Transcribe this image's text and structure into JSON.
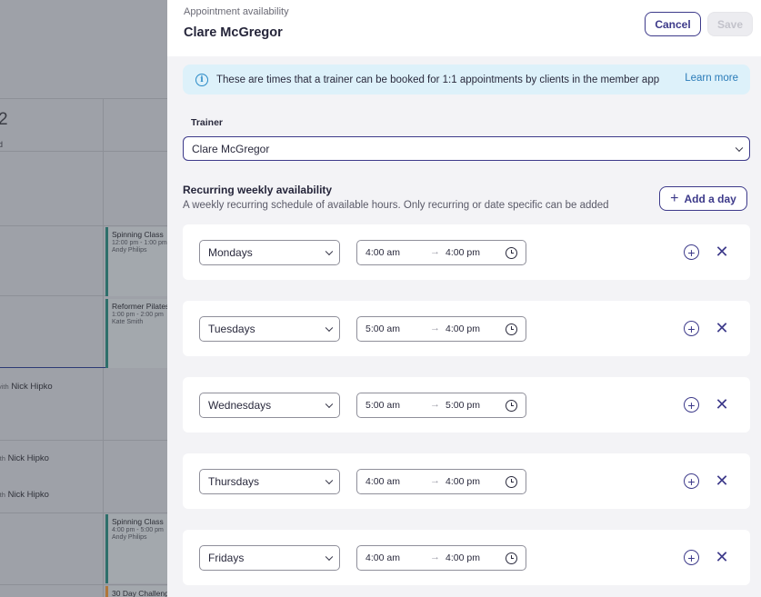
{
  "background_calendar": {
    "day_number": "2",
    "day_sub": "d",
    "events": [
      {
        "title": "Spinning Class",
        "time": "12:00 pm - 1:00 pm",
        "trainer": "Andy Philips"
      },
      {
        "title": "Reformer Pilates",
        "time": "1:00 pm - 2:00 pm",
        "trainer": "Kate Smith"
      },
      {
        "title": "Spinning Class",
        "time": "4:00 pm - 5:00 pm",
        "trainer": "Andy Philips"
      },
      {
        "title": "30 Day Challeng",
        "time": "",
        "trainer": ""
      }
    ],
    "with_prefix": "vith",
    "with_prefix_short": "ith",
    "with_name": "Nick Hipko"
  },
  "drawer": {
    "eyebrow": "Appointment availability",
    "title": "Clare McGregor",
    "cancel_label": "Cancel",
    "save_label": "Save",
    "info": {
      "text": "These are times that a trainer can be booked for 1:1 appointments by clients in the member app",
      "link": "Learn more"
    },
    "trainer_label": "Trainer",
    "trainer_value": "Clare McGregor",
    "section_title": "Recurring weekly availability",
    "section_sub": "A weekly recurring schedule of available hours. Only recurring or date specific can be added",
    "add_day_label": "Add a day",
    "rows": [
      {
        "day": "Mondays",
        "start": "4:00 am",
        "end": "4:00 pm"
      },
      {
        "day": "Tuesdays",
        "start": "5:00 am",
        "end": "4:00 pm"
      },
      {
        "day": "Wednesdays",
        "start": "5:00 am",
        "end": "5:00 pm"
      },
      {
        "day": "Thursdays",
        "start": "4:00 am",
        "end": "4:00 pm"
      },
      {
        "day": "Fridays",
        "start": "4:00 am",
        "end": "4:00 pm"
      }
    ]
  },
  "colors": {
    "accent": "#3d3a8a",
    "info_bg": "#ddf1fa",
    "info_icon": "#2a8ac7"
  },
  "icons": {
    "info": "info-icon",
    "chevron": "chevron-down-icon",
    "clock": "clock-icon",
    "add": "plus-circle-icon",
    "remove": "close-icon"
  }
}
